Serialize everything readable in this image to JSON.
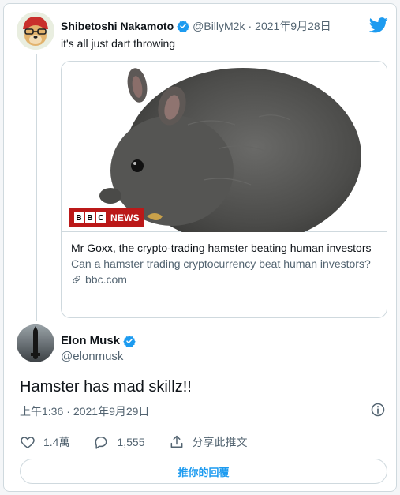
{
  "quoted_tweet": {
    "author_name": "Shibetoshi Nakamoto",
    "handle": "@BillyM2k",
    "separator": "·",
    "date": "2021年9月28日",
    "text": "it's all just dart throwing",
    "link_card": {
      "badge_letters": [
        "B",
        "B",
        "C"
      ],
      "badge_word": "NEWS",
      "title": "Mr Goxx, the crypto-trading hamster beating human investors",
      "description": "Can a hamster trading cryptocurrency beat human investors?",
      "domain": "bbc.com"
    }
  },
  "main_tweet": {
    "author_name": "Elon Musk",
    "handle": "@elonmusk",
    "text": "Hamster has mad skillz!!",
    "time": "上午1:36",
    "separator": "·",
    "date": "2021年9月29日"
  },
  "actions": {
    "likes": "1.4萬",
    "replies": "1,555",
    "share_label": "分享此推文"
  },
  "reply_button_label": "推你的回覆",
  "icons": [
    "verified-badge-icon",
    "twitter-bird-icon",
    "link-icon",
    "info-icon",
    "heart-icon",
    "reply-icon",
    "share-icon"
  ],
  "colors": {
    "accent": "#1d9bf0",
    "secondary_text": "#536471",
    "border": "#cfd9de",
    "bbc_red": "#bb1919"
  }
}
